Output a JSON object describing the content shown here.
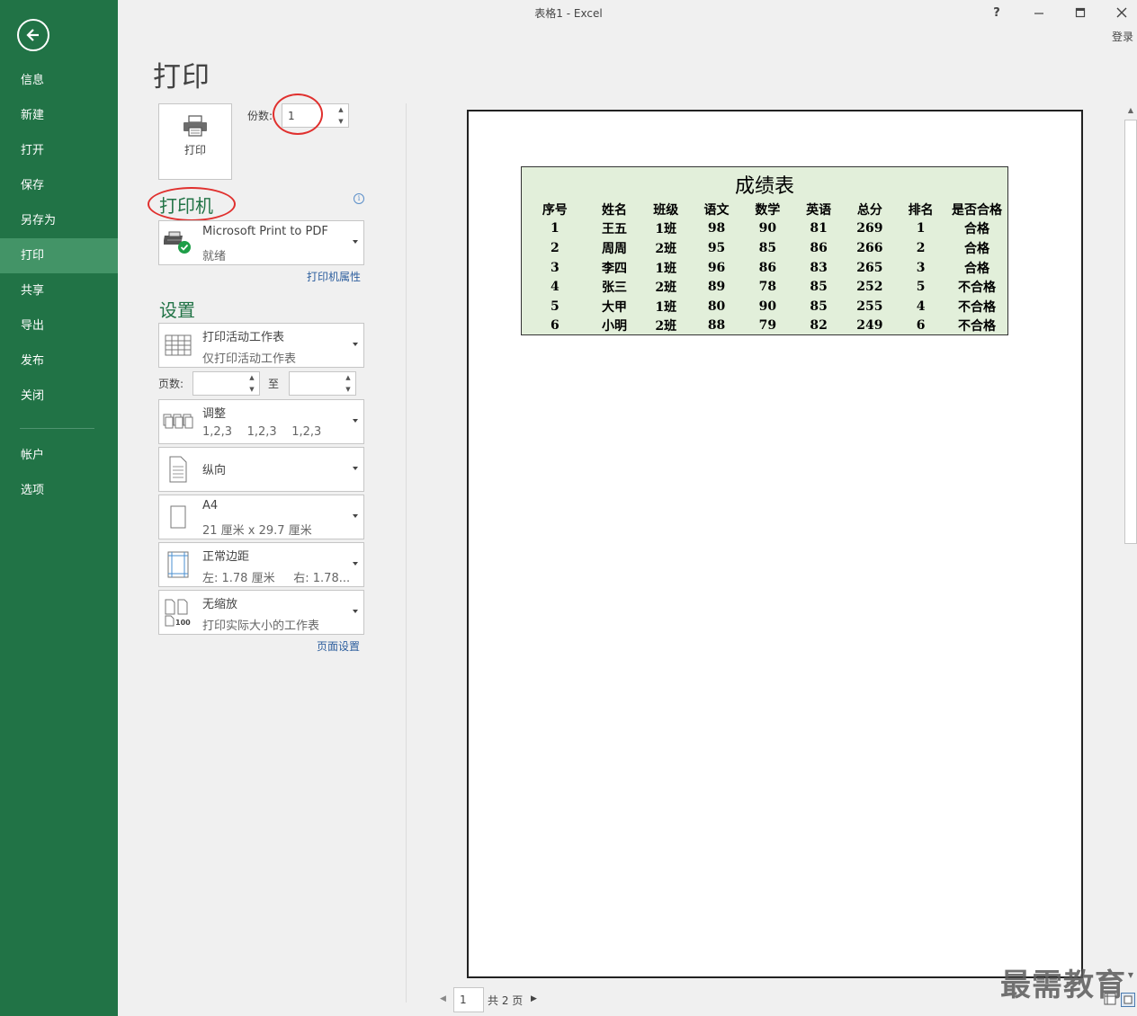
{
  "window": {
    "title": "表格1 - Excel",
    "help": "?",
    "minimize": "—",
    "maximize": "☐",
    "close": "✕",
    "login": "登录"
  },
  "sidebar": {
    "items": [
      {
        "label": "信息"
      },
      {
        "label": "新建"
      },
      {
        "label": "打开"
      },
      {
        "label": "保存"
      },
      {
        "label": "另存为"
      },
      {
        "label": "打印"
      },
      {
        "label": "共享"
      },
      {
        "label": "导出"
      },
      {
        "label": "发布"
      },
      {
        "label": "关闭"
      },
      {
        "label": "帐户"
      },
      {
        "label": "选项"
      }
    ],
    "active": "打印"
  },
  "page_title": "打印",
  "print_button": {
    "label": "打印"
  },
  "copies": {
    "label": "份数:",
    "value": "1"
  },
  "printer": {
    "section_title": "打印机",
    "name": "Microsoft Print to PDF",
    "status": "就绪",
    "properties_link": "打印机属性"
  },
  "settings": {
    "section_title": "设置",
    "what": {
      "title": "打印活动工作表",
      "subtitle": "仅打印活动工作表"
    },
    "pages": {
      "label": "页数:",
      "to_label": "至",
      "from_value": "",
      "to_value": ""
    },
    "collate": {
      "title": "调整",
      "subtitle": "1,2,3    1,2,3    1,2,3"
    },
    "orientation": {
      "title": "纵向"
    },
    "paper": {
      "title": "A4",
      "subtitle": "21 厘米 x 29.7 厘米"
    },
    "margins": {
      "title": "正常边距",
      "subtitle": "左: 1.78 厘米     右: 1.78..."
    },
    "scaling": {
      "title": "无缩放",
      "subtitle": "打印实际大小的工作表",
      "icon_text": "100"
    },
    "page_setup_link": "页面设置"
  },
  "preview": {
    "sheet_title": "成绩表",
    "headers": [
      "序号",
      "姓名",
      "班级",
      "语文",
      "数学",
      "英语",
      "总分",
      "排名",
      "是否合格"
    ],
    "rows": [
      [
        "1",
        "王五",
        "1班",
        "98",
        "90",
        "81",
        "269",
        "1",
        "合格"
      ],
      [
        "2",
        "周周",
        "2班",
        "95",
        "85",
        "86",
        "266",
        "2",
        "合格"
      ],
      [
        "3",
        "李四",
        "1班",
        "96",
        "86",
        "83",
        "265",
        "3",
        "合格"
      ],
      [
        "4",
        "张三",
        "2班",
        "89",
        "78",
        "85",
        "252",
        "5",
        "不合格"
      ],
      [
        "5",
        "大甲",
        "1班",
        "80",
        "90",
        "85",
        "255",
        "4",
        "不合格"
      ],
      [
        "6",
        "小明",
        "2班",
        "88",
        "79",
        "82",
        "249",
        "6",
        "不合格"
      ]
    ],
    "fill_color": "#e2efda"
  },
  "pager": {
    "current": "1",
    "total_label": "共 2 页"
  },
  "watermark": "最需教育",
  "colors": {
    "accent": "#217346",
    "annotation": "#e0302e"
  }
}
